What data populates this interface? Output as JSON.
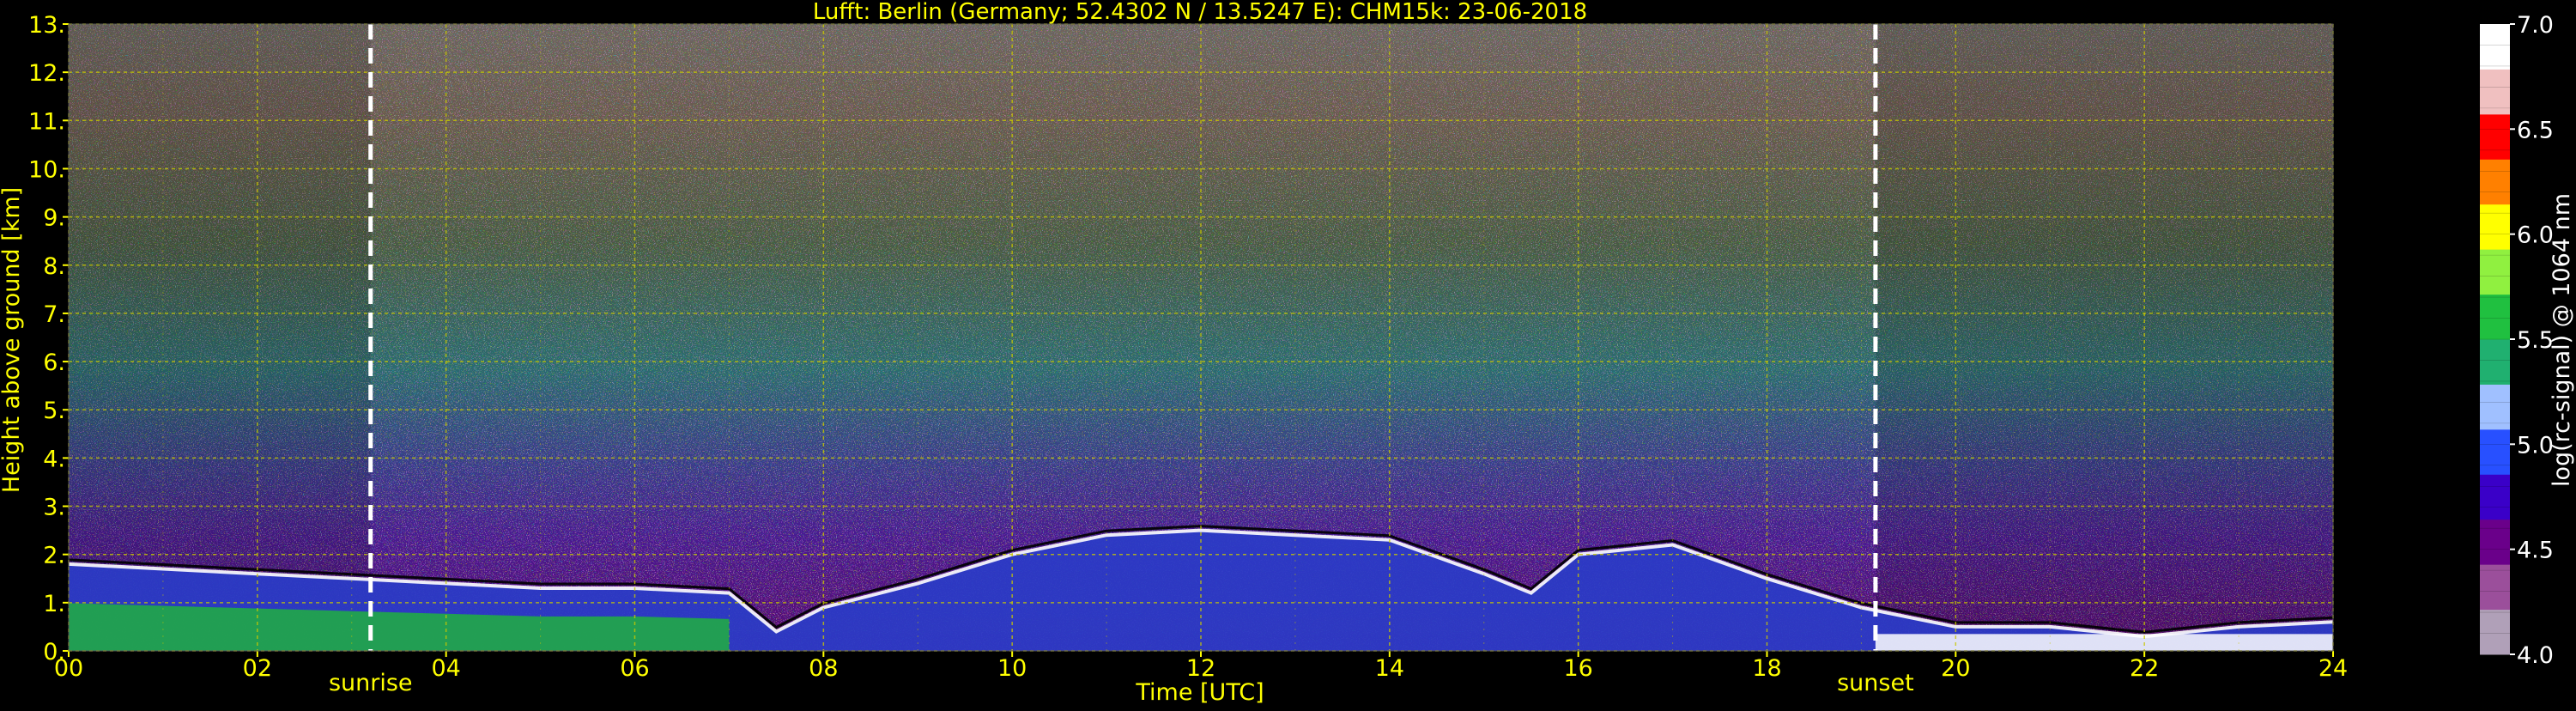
{
  "chart_data": {
    "type": "heatmap",
    "title": "Lufft: Berlin (Germany; 52.4302 N / 13.5247 E):    CHM15k: 23-06-2018",
    "xlabel": "Time [UTC]",
    "ylabel": "Height above ground [km]",
    "xlim": [
      0,
      24
    ],
    "ylim": [
      0,
      13
    ],
    "x_ticks": [
      "00",
      "02",
      "04",
      "06",
      "08",
      "10",
      "12",
      "14",
      "16",
      "18",
      "20",
      "22",
      "24"
    ],
    "y_ticks": [
      "0.",
      "1.",
      "2.",
      "3.",
      "4.",
      "5.",
      "6.",
      "7.",
      "8.",
      "9.",
      "10.",
      "11.",
      "12.",
      "13."
    ],
    "grid": true,
    "events": [
      {
        "label": "sunrise",
        "time": 3.2
      },
      {
        "label": "sunset",
        "time": 19.15
      }
    ],
    "colorbar": {
      "label": "log(rc-signal) @ 1064 nm",
      "range": [
        4.0,
        7.0
      ],
      "ticks": [
        "4.0",
        "4.5",
        "5.0",
        "5.5",
        "6.0",
        "6.5",
        "7.0"
      ]
    },
    "boundary_layer_top_km": {
      "x": [
        0,
        1,
        2,
        3,
        4,
        5,
        6,
        7,
        7.5,
        8,
        9,
        10,
        11,
        12,
        13,
        14,
        15,
        15.5,
        16,
        17,
        18,
        19,
        20,
        21,
        22,
        23,
        24
      ],
      "y": [
        1.8,
        1.7,
        1.6,
        1.5,
        1.4,
        1.3,
        1.3,
        1.2,
        0.4,
        0.9,
        1.4,
        2.0,
        2.4,
        2.5,
        2.4,
        2.3,
        1.6,
        1.2,
        2.0,
        2.2,
        1.5,
        0.9,
        0.5,
        0.5,
        0.3,
        0.5,
        0.6
      ]
    }
  },
  "colors": {
    "background": "#000000",
    "axis_text": "#ffff00",
    "grid": "#c8c800",
    "event_line": "#ffffff",
    "colorbar_stops": [
      "#b0a0b8",
      "#9b4f9b",
      "#6a008a",
      "#3a00c8",
      "#2850ff",
      "#a0c0ff",
      "#20b070",
      "#20c040",
      "#90f040",
      "#ffff00",
      "#ff8000",
      "#ff0000",
      "#f0c0c0",
      "#ffffff"
    ]
  }
}
